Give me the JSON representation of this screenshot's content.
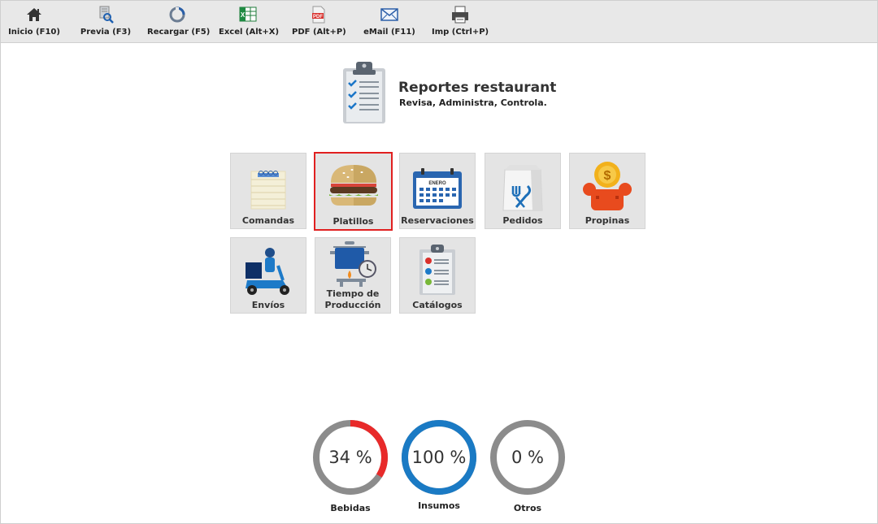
{
  "toolbar": {
    "items": [
      {
        "label": "Inicio (F10)",
        "icon": "home-icon"
      },
      {
        "label": "Previa (F3)",
        "icon": "preview-icon"
      },
      {
        "label": "Recargar (F5)",
        "icon": "reload-icon"
      },
      {
        "label": "Excel (Alt+X)",
        "icon": "excel-icon"
      },
      {
        "label": "PDF (Alt+P)",
        "icon": "pdf-icon"
      },
      {
        "label": "eMail (F11)",
        "icon": "email-icon"
      },
      {
        "label": "Imp (Ctrl+P)",
        "icon": "print-icon"
      }
    ]
  },
  "header": {
    "title": "Reportes restaurant",
    "subtitle": "Revisa, Administra, Controla.",
    "icon": "clipboard-checklist-icon"
  },
  "tiles": [
    {
      "label": "Comandas",
      "icon": "notepad-icon",
      "selected": false
    },
    {
      "label": "Platillos",
      "icon": "burger-icon",
      "selected": true
    },
    {
      "label": "Reservaciones",
      "icon": "calendar-icon",
      "calendar_text": "ENERO",
      "selected": false
    },
    {
      "label": "Pedidos",
      "icon": "takeout-bag-icon",
      "selected": false
    },
    {
      "label": "Propinas",
      "icon": "tip-coin-icon",
      "selected": false
    },
    {
      "label": "Envíos",
      "icon": "delivery-scooter-icon",
      "selected": false
    },
    {
      "label1": "Tiempo de",
      "label2": "Producción",
      "icon": "cooking-pot-timer-icon",
      "selected": false
    },
    {
      "label": "Catálogos",
      "icon": "catalog-clipboard-icon",
      "selected": false
    }
  ],
  "gauges": [
    {
      "label": "Bebidas",
      "value_text": "34 %",
      "value": 34,
      "color": "#e82a2a",
      "track": "#8c8c8c"
    },
    {
      "label": "Insumos",
      "value_text": "100 %",
      "value": 100,
      "color": "#1a7ac4",
      "track": "#8c8c8c"
    },
    {
      "label": "Otros",
      "value_text": "0 %",
      "value": 0,
      "color": "#8c8c8c",
      "track": "#8c8c8c"
    }
  ],
  "colors": {
    "selected_border": "#e02020",
    "tile_bg": "#e4e4e4",
    "toolbar_bg": "#e8e8e8"
  }
}
